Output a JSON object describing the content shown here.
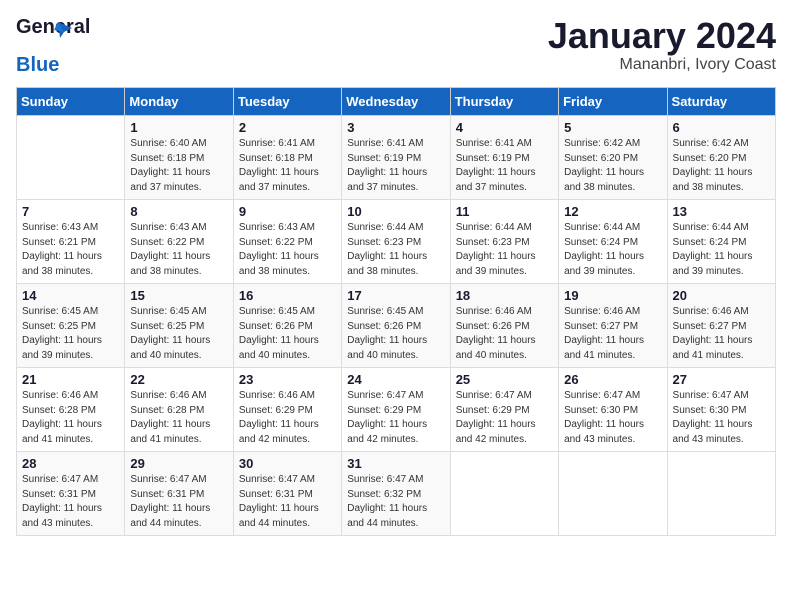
{
  "logo": {
    "line1": "General",
    "line2": "Blue"
  },
  "title": "January 2024",
  "subtitle": "Mananbri, Ivory Coast",
  "days_header": [
    "Sunday",
    "Monday",
    "Tuesday",
    "Wednesday",
    "Thursday",
    "Friday",
    "Saturday"
  ],
  "weeks": [
    [
      {
        "day": "",
        "info": ""
      },
      {
        "day": "1",
        "info": "Sunrise: 6:40 AM\nSunset: 6:18 PM\nDaylight: 11 hours\nand 37 minutes."
      },
      {
        "day": "2",
        "info": "Sunrise: 6:41 AM\nSunset: 6:18 PM\nDaylight: 11 hours\nand 37 minutes."
      },
      {
        "day": "3",
        "info": "Sunrise: 6:41 AM\nSunset: 6:19 PM\nDaylight: 11 hours\nand 37 minutes."
      },
      {
        "day": "4",
        "info": "Sunrise: 6:41 AM\nSunset: 6:19 PM\nDaylight: 11 hours\nand 37 minutes."
      },
      {
        "day": "5",
        "info": "Sunrise: 6:42 AM\nSunset: 6:20 PM\nDaylight: 11 hours\nand 38 minutes."
      },
      {
        "day": "6",
        "info": "Sunrise: 6:42 AM\nSunset: 6:20 PM\nDaylight: 11 hours\nand 38 minutes."
      }
    ],
    [
      {
        "day": "7",
        "info": "Sunrise: 6:43 AM\nSunset: 6:21 PM\nDaylight: 11 hours\nand 38 minutes."
      },
      {
        "day": "8",
        "info": "Sunrise: 6:43 AM\nSunset: 6:22 PM\nDaylight: 11 hours\nand 38 minutes."
      },
      {
        "day": "9",
        "info": "Sunrise: 6:43 AM\nSunset: 6:22 PM\nDaylight: 11 hours\nand 38 minutes."
      },
      {
        "day": "10",
        "info": "Sunrise: 6:44 AM\nSunset: 6:23 PM\nDaylight: 11 hours\nand 38 minutes."
      },
      {
        "day": "11",
        "info": "Sunrise: 6:44 AM\nSunset: 6:23 PM\nDaylight: 11 hours\nand 39 minutes."
      },
      {
        "day": "12",
        "info": "Sunrise: 6:44 AM\nSunset: 6:24 PM\nDaylight: 11 hours\nand 39 minutes."
      },
      {
        "day": "13",
        "info": "Sunrise: 6:44 AM\nSunset: 6:24 PM\nDaylight: 11 hours\nand 39 minutes."
      }
    ],
    [
      {
        "day": "14",
        "info": "Sunrise: 6:45 AM\nSunset: 6:25 PM\nDaylight: 11 hours\nand 39 minutes."
      },
      {
        "day": "15",
        "info": "Sunrise: 6:45 AM\nSunset: 6:25 PM\nDaylight: 11 hours\nand 40 minutes."
      },
      {
        "day": "16",
        "info": "Sunrise: 6:45 AM\nSunset: 6:26 PM\nDaylight: 11 hours\nand 40 minutes."
      },
      {
        "day": "17",
        "info": "Sunrise: 6:45 AM\nSunset: 6:26 PM\nDaylight: 11 hours\nand 40 minutes."
      },
      {
        "day": "18",
        "info": "Sunrise: 6:46 AM\nSunset: 6:26 PM\nDaylight: 11 hours\nand 40 minutes."
      },
      {
        "day": "19",
        "info": "Sunrise: 6:46 AM\nSunset: 6:27 PM\nDaylight: 11 hours\nand 41 minutes."
      },
      {
        "day": "20",
        "info": "Sunrise: 6:46 AM\nSunset: 6:27 PM\nDaylight: 11 hours\nand 41 minutes."
      }
    ],
    [
      {
        "day": "21",
        "info": "Sunrise: 6:46 AM\nSunset: 6:28 PM\nDaylight: 11 hours\nand 41 minutes."
      },
      {
        "day": "22",
        "info": "Sunrise: 6:46 AM\nSunset: 6:28 PM\nDaylight: 11 hours\nand 41 minutes."
      },
      {
        "day": "23",
        "info": "Sunrise: 6:46 AM\nSunset: 6:29 PM\nDaylight: 11 hours\nand 42 minutes."
      },
      {
        "day": "24",
        "info": "Sunrise: 6:47 AM\nSunset: 6:29 PM\nDaylight: 11 hours\nand 42 minutes."
      },
      {
        "day": "25",
        "info": "Sunrise: 6:47 AM\nSunset: 6:29 PM\nDaylight: 11 hours\nand 42 minutes."
      },
      {
        "day": "26",
        "info": "Sunrise: 6:47 AM\nSunset: 6:30 PM\nDaylight: 11 hours\nand 43 minutes."
      },
      {
        "day": "27",
        "info": "Sunrise: 6:47 AM\nSunset: 6:30 PM\nDaylight: 11 hours\nand 43 minutes."
      }
    ],
    [
      {
        "day": "28",
        "info": "Sunrise: 6:47 AM\nSunset: 6:31 PM\nDaylight: 11 hours\nand 43 minutes."
      },
      {
        "day": "29",
        "info": "Sunrise: 6:47 AM\nSunset: 6:31 PM\nDaylight: 11 hours\nand 44 minutes."
      },
      {
        "day": "30",
        "info": "Sunrise: 6:47 AM\nSunset: 6:31 PM\nDaylight: 11 hours\nand 44 minutes."
      },
      {
        "day": "31",
        "info": "Sunrise: 6:47 AM\nSunset: 6:32 PM\nDaylight: 11 hours\nand 44 minutes."
      },
      {
        "day": "",
        "info": ""
      },
      {
        "day": "",
        "info": ""
      },
      {
        "day": "",
        "info": ""
      }
    ]
  ]
}
